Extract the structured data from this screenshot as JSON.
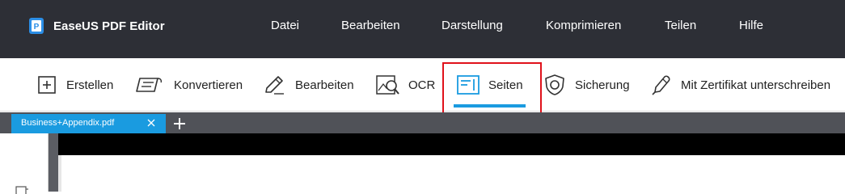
{
  "app": {
    "name": "EaseUS PDF Editor",
    "logo_icon": "easeus-pdf-logo-icon"
  },
  "menu": [
    "Datei",
    "Bearbeiten",
    "Darstellung",
    "Komprimieren",
    "Teilen",
    "Hilfe"
  ],
  "toolbar": {
    "items": [
      {
        "label": "Erstellen",
        "icon": "plus-box-icon"
      },
      {
        "label": "Konvertieren",
        "icon": "convert-document-icon"
      },
      {
        "label": "Bearbeiten",
        "icon": "edit-pencil-icon"
      },
      {
        "label": "OCR",
        "icon": "ocr-scan-icon"
      },
      {
        "label": "Seiten",
        "icon": "pages-icon",
        "active": true
      },
      {
        "label": "Sicherung",
        "icon": "shield-icon"
      },
      {
        "label": "Mit Zertifikat unterschreiben",
        "icon": "sign-pen-icon"
      }
    ]
  },
  "tabs": {
    "open": [
      {
        "label": "Business+Appendix.pdf",
        "active": true
      }
    ],
    "close_icon": "close-icon",
    "add_icon": "plus-icon"
  },
  "colors": {
    "titlebar": "#2d2f36",
    "accent": "#1a9be0",
    "highlight": "#e0121b"
  }
}
